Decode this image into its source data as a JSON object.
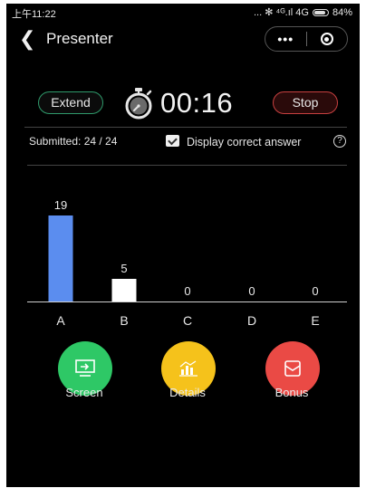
{
  "status_bar": {
    "time": "上午11:22",
    "signal": "... ✻ ⁴ᴳ.ıl 4G",
    "battery": "84%"
  },
  "nav": {
    "title": "Presenter",
    "more": "•••"
  },
  "controls": {
    "extend": "Extend",
    "timer": "00:16",
    "stop": "Stop"
  },
  "summary": {
    "submitted": "Submitted: 24 / 24",
    "display_correct": "Display correct answer",
    "help": "?"
  },
  "chart_data": {
    "type": "bar",
    "categories": [
      "A",
      "B",
      "C",
      "D",
      "E"
    ],
    "values": [
      19,
      5,
      0,
      0,
      0
    ],
    "colors": [
      "#5b8def",
      "#ffffff",
      "#ffffff",
      "#ffffff",
      "#ffffff"
    ],
    "ylim": [
      0,
      19
    ]
  },
  "actions": [
    {
      "label": "Screen",
      "color": "#2ec866",
      "icon": "screen-share-icon"
    },
    {
      "label": "Details",
      "color": "#f5c21b",
      "icon": "bar-chart-icon"
    },
    {
      "label": "Bonus",
      "color": "#ea4a45",
      "icon": "envelope-icon"
    }
  ]
}
